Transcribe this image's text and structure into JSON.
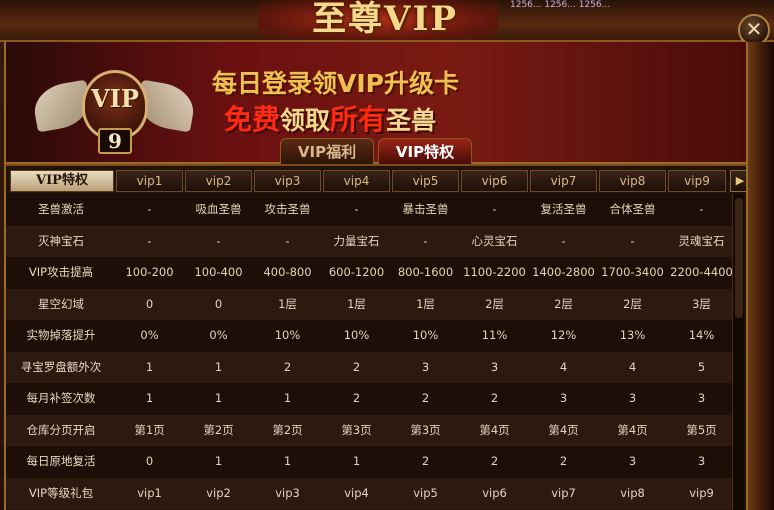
{
  "window": {
    "title": "至尊VIP",
    "top_deco_text": "1256... 1256... 1256...",
    "close_glyph": "✕"
  },
  "banner": {
    "vip_badge_text": "VIP",
    "vip_level": "9",
    "line1": "每日登录领VIP升级卡",
    "line2_part1": "免费",
    "line2_part2": "领取",
    "line2_part3": "所有",
    "line2_part4": "圣兽"
  },
  "tabs": [
    {
      "label": "VIP福利",
      "active": false
    },
    {
      "label": "VIP特权",
      "active": true
    }
  ],
  "table": {
    "header_first": "VIP特权",
    "columns": [
      "vip1",
      "vip2",
      "vip3",
      "vip4",
      "vip5",
      "vip6",
      "vip7",
      "vip8",
      "vip9"
    ],
    "next_glyph": "▶",
    "rows": [
      {
        "label": "圣兽激活",
        "values": [
          "-",
          "吸血圣兽",
          "攻击圣兽",
          "-",
          "暴击圣兽",
          "-",
          "复活圣兽",
          "合体圣兽",
          "-"
        ]
      },
      {
        "label": "灭神宝石",
        "values": [
          "-",
          "-",
          "-",
          "力量宝石",
          "-",
          "心灵宝石",
          "-",
          "-",
          "灵魂宝石"
        ]
      },
      {
        "label": "VIP攻击提高",
        "values": [
          "100-200",
          "100-400",
          "400-800",
          "600-1200",
          "800-1600",
          "1100-2200",
          "1400-2800",
          "1700-3400",
          "2200-4400"
        ]
      },
      {
        "label": "星空幻域",
        "values": [
          "0",
          "0",
          "1层",
          "1层",
          "1层",
          "2层",
          "2层",
          "2层",
          "3层"
        ]
      },
      {
        "label": "实物掉落提升",
        "values": [
          "0%",
          "0%",
          "10%",
          "10%",
          "10%",
          "11%",
          "12%",
          "13%",
          "14%"
        ]
      },
      {
        "label": "寻宝罗盘额外次",
        "values": [
          "1",
          "1",
          "2",
          "2",
          "3",
          "3",
          "4",
          "4",
          "5"
        ]
      },
      {
        "label": "每月补签次数",
        "values": [
          "1",
          "1",
          "1",
          "2",
          "2",
          "2",
          "3",
          "3",
          "3"
        ]
      },
      {
        "label": "仓库分页开启",
        "values": [
          "第1页",
          "第2页",
          "第2页",
          "第3页",
          "第3页",
          "第4页",
          "第4页",
          "第4页",
          "第5页"
        ]
      },
      {
        "label": "每日原地复活",
        "values": [
          "0",
          "1",
          "1",
          "1",
          "2",
          "2",
          "2",
          "3",
          "3"
        ]
      },
      {
        "label": "VIP等级礼包",
        "values": [
          "vip1",
          "vip2",
          "vip3",
          "vip4",
          "vip5",
          "vip6",
          "vip7",
          "vip8",
          "vip9"
        ]
      }
    ]
  },
  "colors": {
    "accent_gold": "#f0c050",
    "highlight_red": "#ff2a10",
    "active_tab": "#9a2418"
  }
}
